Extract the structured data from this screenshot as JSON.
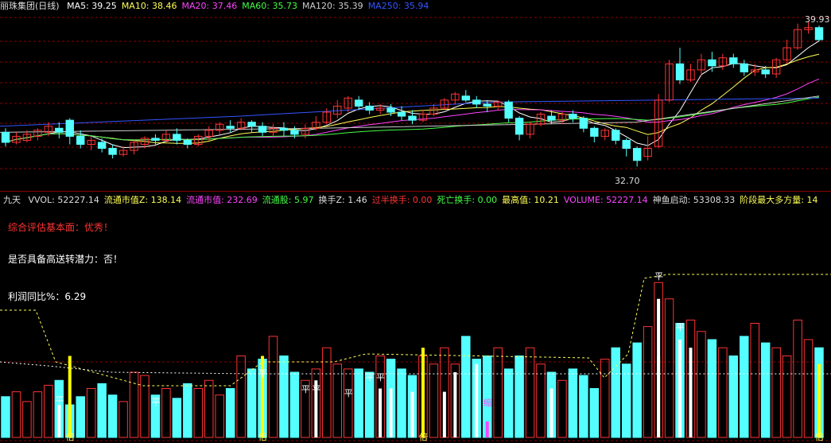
{
  "price_panel": {
    "title": "丽珠集团(日线)",
    "ma": [
      {
        "label": "MA5: 39.25",
        "color": "#ffffff"
      },
      {
        "label": "MA10: 38.46",
        "color": "#ffff55"
      },
      {
        "label": "MA20: 37.46",
        "color": "#ff44ff"
      },
      {
        "label": "MA60: 35.73",
        "color": "#44ff44"
      },
      {
        "label": "MA120: 35.39",
        "color": "#cccccc"
      },
      {
        "label": "MA250: 35.94",
        "color": "#3355ff"
      }
    ],
    "high_label": "39.93",
    "low_label": "32.70"
  },
  "indicator_panel": {
    "title": "九天",
    "fields": [
      {
        "label": "VVOL: 52227.14",
        "color": "#dddddd"
      },
      {
        "label": "流通市值Z: 138.14",
        "color": "#ffff55"
      },
      {
        "label": "流通市值: 232.69",
        "color": "#ff44ff"
      },
      {
        "label": "流通股: 5.97",
        "color": "#44ff44"
      },
      {
        "label": "换手Z: 1.46",
        "color": "#dddddd"
      },
      {
        "label": "过半换手: 0.00",
        "color": "#ff3333"
      },
      {
        "label": "死亡换手: 0.00",
        "color": "#44ff44"
      },
      {
        "label": "最高值: 10.21",
        "color": "#ffff55"
      },
      {
        "label": "VOLUME: 52227.14",
        "color": "#ff44ff"
      },
      {
        "label": "神鱼启动: 53308.33",
        "color": "#dddddd"
      },
      {
        "label": "阶段最大多方量: 14",
        "color": "#ffff55"
      }
    ],
    "notes": [
      {
        "text": "综合评估基本面：优秀！",
        "color": "#ff3333"
      },
      {
        "text": "是否具备高送转潜力：否！",
        "color": "#ffffff"
      },
      {
        "text": "利润同比%：6.29",
        "color": "#ffffff"
      }
    ],
    "marker_ping": "平",
    "marker_bei": "倍",
    "marker_suo": "缩"
  },
  "colors": {
    "up": "#ff3333",
    "down": "#54ffff",
    "grid": "#8b0000",
    "bg": "#000000"
  },
  "chart_data": {
    "type": "candlestick",
    "ohlc": [
      [
        34.4,
        33.9,
        34.6,
        33.7
      ],
      [
        33.9,
        34.2,
        34.4,
        33.8
      ],
      [
        34.0,
        34.3,
        34.5,
        33.9
      ],
      [
        34.2,
        34.5,
        34.6,
        34.0
      ],
      [
        34.4,
        34.7,
        34.9,
        34.2
      ],
      [
        34.6,
        34.4,
        34.9,
        34.1
      ],
      [
        35.0,
        34.2,
        35.1,
        33.8
      ],
      [
        34.2,
        33.8,
        34.5,
        33.6
      ],
      [
        33.8,
        34.0,
        34.2,
        33.5
      ],
      [
        33.9,
        33.6,
        34.1,
        33.4
      ],
      [
        33.6,
        33.3,
        33.8,
        33.1
      ],
      [
        33.3,
        33.5,
        33.7,
        33.2
      ],
      [
        33.5,
        33.9,
        34.0,
        33.3
      ],
      [
        33.8,
        34.1,
        34.2,
        33.6
      ],
      [
        34.1,
        34.0,
        34.3,
        33.8
      ],
      [
        34.0,
        34.3,
        34.5,
        33.9
      ],
      [
        34.3,
        34.0,
        34.6,
        33.8
      ],
      [
        34.0,
        33.8,
        34.1,
        33.6
      ],
      [
        33.8,
        34.2,
        34.3,
        33.7
      ],
      [
        34.2,
        34.5,
        34.7,
        34.0
      ],
      [
        34.5,
        34.8,
        34.9,
        34.3
      ],
      [
        34.7,
        34.6,
        35.0,
        34.4
      ],
      [
        34.6,
        34.9,
        35.1,
        34.5
      ],
      [
        34.9,
        34.7,
        35.0,
        34.4
      ],
      [
        34.7,
        34.4,
        34.9,
        34.2
      ],
      [
        34.4,
        34.6,
        34.8,
        34.2
      ],
      [
        34.6,
        34.5,
        34.9,
        34.2
      ],
      [
        34.5,
        34.3,
        34.7,
        34.1
      ],
      [
        34.3,
        34.6,
        34.8,
        34.1
      ],
      [
        34.6,
        34.9,
        35.2,
        34.5
      ],
      [
        34.9,
        35.4,
        35.6,
        34.8
      ],
      [
        35.3,
        35.7,
        36.0,
        35.1
      ],
      [
        35.6,
        36.1,
        36.2,
        35.4
      ],
      [
        36.0,
        35.7,
        36.2,
        35.5
      ],
      [
        35.7,
        35.5,
        35.9,
        35.3
      ],
      [
        35.5,
        35.6,
        35.8,
        35.3
      ],
      [
        35.6,
        35.4,
        35.8,
        35.2
      ],
      [
        35.4,
        35.2,
        35.7,
        35.0
      ],
      [
        35.2,
        35.0,
        35.5,
        34.8
      ],
      [
        35.0,
        35.3,
        35.5,
        34.9
      ],
      [
        35.3,
        35.6,
        35.8,
        35.2
      ],
      [
        35.6,
        36.0,
        36.1,
        35.5
      ],
      [
        36.0,
        36.3,
        36.4,
        35.8
      ],
      [
        36.2,
        36.0,
        36.5,
        35.9
      ],
      [
        36.0,
        35.8,
        36.2,
        35.6
      ],
      [
        35.8,
        35.7,
        36.0,
        35.4
      ],
      [
        35.7,
        35.9,
        36.0,
        35.5
      ],
      [
        35.9,
        35.1,
        36.0,
        34.9
      ],
      [
        35.1,
        34.3,
        35.2,
        34.0
      ],
      [
        34.3,
        34.8,
        34.9,
        34.1
      ],
      [
        34.8,
        35.3,
        35.4,
        34.7
      ],
      [
        35.2,
        35.0,
        35.5,
        34.8
      ],
      [
        35.0,
        35.3,
        35.4,
        34.8
      ],
      [
        35.3,
        35.1,
        35.5,
        34.9
      ],
      [
        35.1,
        34.6,
        35.2,
        34.4
      ],
      [
        34.6,
        34.2,
        34.7,
        33.9
      ],
      [
        34.2,
        34.5,
        34.6,
        34.0
      ],
      [
        34.5,
        34.0,
        34.6,
        33.8
      ],
      [
        34.0,
        33.6,
        34.1,
        33.2
      ],
      [
        33.6,
        33.0,
        33.7,
        32.7
      ],
      [
        33.2,
        33.6,
        34.2,
        33.0
      ],
      [
        33.7,
        36.0,
        36.3,
        33.6
      ],
      [
        36.0,
        37.8,
        38.0,
        35.9
      ],
      [
        37.8,
        37.0,
        38.6,
        36.8
      ],
      [
        37.0,
        37.5,
        37.8,
        36.9
      ],
      [
        37.5,
        38.0,
        38.3,
        37.2
      ],
      [
        38.0,
        37.7,
        38.4,
        37.4
      ],
      [
        37.7,
        38.1,
        38.3,
        37.5
      ],
      [
        38.1,
        37.8,
        38.3,
        37.6
      ],
      [
        37.8,
        37.4,
        38.0,
        37.2
      ],
      [
        37.4,
        37.5,
        37.8,
        37.2
      ],
      [
        37.5,
        37.3,
        37.7,
        37.1
      ],
      [
        37.3,
        38.0,
        38.1,
        37.1
      ],
      [
        38.0,
        38.6,
        39.0,
        37.8
      ],
      [
        38.6,
        39.5,
        39.8,
        38.5
      ],
      [
        39.5,
        39.6,
        39.9,
        39.3
      ],
      [
        39.6,
        39.0,
        39.7,
        38.9
      ]
    ],
    "ylim": [
      32.2,
      40.3
    ]
  }
}
